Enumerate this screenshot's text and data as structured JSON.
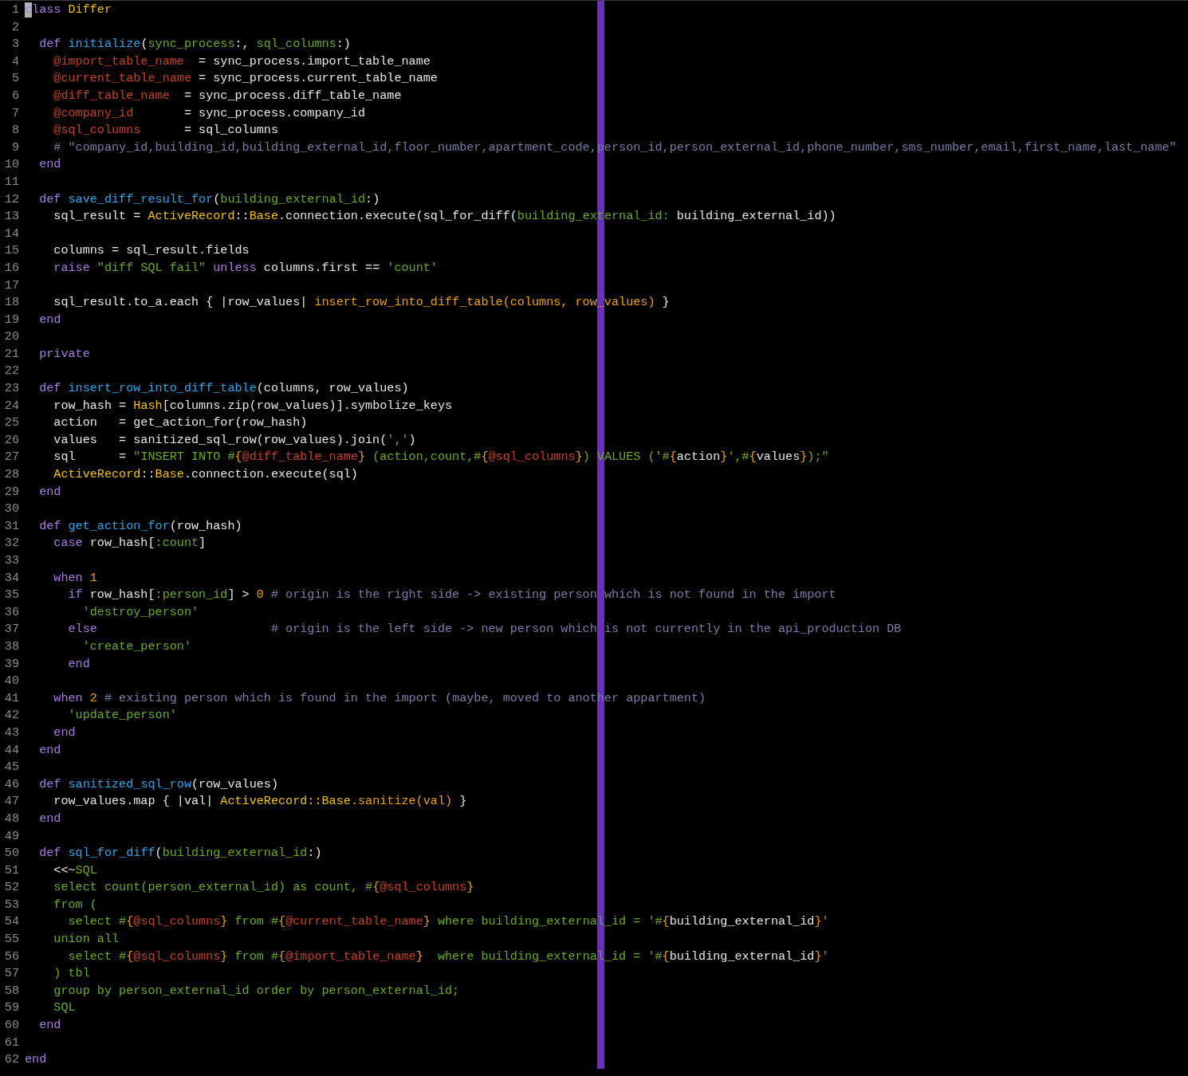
{
  "lines": [
    {
      "number": "1",
      "cursor": true,
      "tokens": [
        {
          "kind": "keyword",
          "text": "class"
        },
        {
          "kind": "constant",
          "text": " Differ"
        }
      ]
    },
    {
      "number": "2",
      "cursor": false
    },
    {
      "number": "3",
      "cursor": false,
      "tokens": [
        {
          "kind": "keyword",
          "text": "  def"
        },
        {
          "kind": "function",
          "text": " initialize"
        },
        {
          "kind": "plain",
          "text": "("
        },
        {
          "kind": "param",
          "text": "sync_process"
        },
        {
          "kind": "plain",
          "text": ":, "
        },
        {
          "kind": "param",
          "text": "sql_columns"
        },
        {
          "kind": "plain",
          "text": ":)"
        }
      ]
    },
    {
      "number": "4",
      "cursor": false,
      "tokens": [
        {
          "kind": "ivar",
          "text": "    @import_table_name"
        },
        {
          "kind": "plain",
          "text": "  = sync_process.import_table_name"
        }
      ]
    },
    {
      "number": "5",
      "cursor": false,
      "tokens": [
        {
          "kind": "ivar",
          "text": "    @current_table_name"
        },
        {
          "kind": "plain",
          "text": " = sync_process.current_table_name"
        }
      ]
    },
    {
      "number": "6",
      "cursor": false,
      "tokens": [
        {
          "kind": "ivar",
          "text": "    @diff_table_name"
        },
        {
          "kind": "plain",
          "text": "  = sync_process.diff_table_name"
        }
      ]
    },
    {
      "number": "7",
      "cursor": false,
      "tokens": [
        {
          "kind": "ivar",
          "text": "    @company_id"
        },
        {
          "kind": "plain",
          "text": "       = sync_process.company_id"
        }
      ]
    },
    {
      "number": "8",
      "cursor": false,
      "tokens": [
        {
          "kind": "ivar",
          "text": "    @sql_columns"
        },
        {
          "kind": "plain",
          "text": "      = sql_columns"
        }
      ]
    },
    {
      "number": "9",
      "cursor": false,
      "tokens": [
        {
          "kind": "comment",
          "text": "    # \"company_id,building_id,building_external_id,floor_number,apartment_code,person_id,person_external_id,phone_number,sms_number,email,first_name,last_name\""
        }
      ]
    },
    {
      "number": "10",
      "cursor": false,
      "tokens": [
        {
          "kind": "keyword",
          "text": "  end"
        }
      ]
    },
    {
      "number": "11",
      "cursor": false
    },
    {
      "number": "12",
      "cursor": false,
      "tokens": [
        {
          "kind": "keyword",
          "text": "  def"
        },
        {
          "kind": "function",
          "text": " save_diff_result_for"
        },
        {
          "kind": "plain",
          "text": "("
        },
        {
          "kind": "param",
          "text": "building_external_id"
        },
        {
          "kind": "plain",
          "text": ":)"
        }
      ]
    },
    {
      "number": "13",
      "cursor": false,
      "tokens": [
        {
          "kind": "plain",
          "text": "    sql_result = "
        },
        {
          "kind": "constant",
          "text": "ActiveRecord"
        },
        {
          "kind": "plain",
          "text": "::"
        },
        {
          "kind": "constant",
          "text": "Base"
        },
        {
          "kind": "plain",
          "text": ".connection.execute(sql_for_diff("
        },
        {
          "kind": "param",
          "text": "building_external_id:"
        },
        {
          "kind": "plain",
          "text": " building_external_id))"
        }
      ]
    },
    {
      "number": "14",
      "cursor": false
    },
    {
      "number": "15",
      "cursor": false,
      "tokens": [
        {
          "kind": "plain",
          "text": "    columns = sql_result.fields"
        }
      ]
    },
    {
      "number": "16",
      "cursor": false,
      "tokens": [
        {
          "kind": "keyword",
          "text": "    raise"
        },
        {
          "kind": "string",
          "text": " \"diff SQL fail\""
        },
        {
          "kind": "keyword",
          "text": " unless"
        },
        {
          "kind": "plain",
          "text": " columns.first == "
        },
        {
          "kind": "string",
          "text": "'count'"
        }
      ]
    },
    {
      "number": "17",
      "cursor": false
    },
    {
      "number": "18",
      "cursor": false,
      "tokens": [
        {
          "kind": "plain",
          "text": "    sql_result.to_a.each { |row_values| "
        },
        {
          "kind": "call",
          "text": "insert_row_into_diff_table(columns, row_values)"
        },
        {
          "kind": "plain",
          "text": " }"
        }
      ]
    },
    {
      "number": "19",
      "cursor": false,
      "tokens": [
        {
          "kind": "keyword",
          "text": "  end"
        }
      ]
    },
    {
      "number": "20",
      "cursor": false
    },
    {
      "number": "21",
      "cursor": false,
      "tokens": [
        {
          "kind": "keyword",
          "text": "  private"
        }
      ]
    },
    {
      "number": "22",
      "cursor": false
    },
    {
      "number": "23",
      "cursor": false,
      "tokens": [
        {
          "kind": "keyword",
          "text": "  def"
        },
        {
          "kind": "function",
          "text": " insert_row_into_diff_table"
        },
        {
          "kind": "plain",
          "text": "(columns, row_values)"
        }
      ]
    },
    {
      "number": "24",
      "cursor": false,
      "tokens": [
        {
          "kind": "plain",
          "text": "    row_hash = "
        },
        {
          "kind": "constant",
          "text": "Hash"
        },
        {
          "kind": "plain",
          "text": "[columns.zip(row_values)].symbolize_keys"
        }
      ]
    },
    {
      "number": "25",
      "cursor": false,
      "tokens": [
        {
          "kind": "plain",
          "text": "    action   = get_action_for(row_hash)"
        }
      ]
    },
    {
      "number": "26",
      "cursor": false,
      "tokens": [
        {
          "kind": "plain",
          "text": "    values   = sanitized_sql_row(row_values).join("
        },
        {
          "kind": "string",
          "text": "','"
        },
        {
          "kind": "plain",
          "text": ")"
        }
      ]
    },
    {
      "number": "27",
      "cursor": false,
      "tokens": [
        {
          "kind": "plain",
          "text": "    sql      = "
        },
        {
          "kind": "string",
          "text": "\"INSERT INTO #"
        },
        {
          "kind": "interp",
          "text": "{"
        },
        {
          "kind": "ivar",
          "text": "@diff_table_name"
        },
        {
          "kind": "interp",
          "text": "}"
        },
        {
          "kind": "string",
          "text": " (action,count,#"
        },
        {
          "kind": "interp",
          "text": "{"
        },
        {
          "kind": "ivar",
          "text": "@sql_columns"
        },
        {
          "kind": "interp",
          "text": "}"
        },
        {
          "kind": "string",
          "text": ") VALUES ('#"
        },
        {
          "kind": "interp",
          "text": "{"
        },
        {
          "kind": "plain",
          "text": "action"
        },
        {
          "kind": "interp",
          "text": "}"
        },
        {
          "kind": "string",
          "text": "',#"
        },
        {
          "kind": "interp",
          "text": "{"
        },
        {
          "kind": "plain",
          "text": "values"
        },
        {
          "kind": "interp",
          "text": "}"
        },
        {
          "kind": "string",
          "text": ");\""
        }
      ]
    },
    {
      "number": "28",
      "cursor": false,
      "tokens": [
        {
          "kind": "constant",
          "text": "    ActiveRecord"
        },
        {
          "kind": "plain",
          "text": "::"
        },
        {
          "kind": "constant",
          "text": "Base"
        },
        {
          "kind": "plain",
          "text": ".connection.execute(sql)"
        }
      ]
    },
    {
      "number": "29",
      "cursor": false,
      "tokens": [
        {
          "kind": "keyword",
          "text": "  end"
        }
      ]
    },
    {
      "number": "30",
      "cursor": false
    },
    {
      "number": "31",
      "cursor": false,
      "tokens": [
        {
          "kind": "keyword",
          "text": "  def"
        },
        {
          "kind": "function",
          "text": " get_action_for"
        },
        {
          "kind": "plain",
          "text": "(row_hash)"
        }
      ]
    },
    {
      "number": "32",
      "cursor": false,
      "tokens": [
        {
          "kind": "keyword",
          "text": "    case"
        },
        {
          "kind": "plain",
          "text": " row_hash["
        },
        {
          "kind": "string",
          "text": ":count"
        },
        {
          "kind": "plain",
          "text": "]"
        }
      ]
    },
    {
      "number": "33",
      "cursor": false
    },
    {
      "number": "34",
      "cursor": false,
      "tokens": [
        {
          "kind": "keyword",
          "text": "    when"
        },
        {
          "kind": "number",
          "text": " 1"
        }
      ]
    },
    {
      "number": "35",
      "cursor": false,
      "tokens": [
        {
          "kind": "keyword",
          "text": "      if"
        },
        {
          "kind": "plain",
          "text": " row_hash["
        },
        {
          "kind": "string",
          "text": ":person_id"
        },
        {
          "kind": "plain",
          "text": "] > "
        },
        {
          "kind": "number",
          "text": "0"
        },
        {
          "kind": "comment",
          "text": " # origin is the right side -> existing person which is not found in the import"
        }
      ]
    },
    {
      "number": "36",
      "cursor": false,
      "tokens": [
        {
          "kind": "string",
          "text": "        'destroy_person'"
        }
      ]
    },
    {
      "number": "37",
      "cursor": false,
      "tokens": [
        {
          "kind": "keyword",
          "text": "      else"
        },
        {
          "kind": "comment",
          "text": "                        # origin is the left side -> new person which is not currently in the api_production DB"
        }
      ]
    },
    {
      "number": "38",
      "cursor": false,
      "tokens": [
        {
          "kind": "string",
          "text": "        'create_person'"
        }
      ]
    },
    {
      "number": "39",
      "cursor": false,
      "tokens": [
        {
          "kind": "keyword",
          "text": "      end"
        }
      ]
    },
    {
      "number": "40",
      "cursor": false
    },
    {
      "number": "41",
      "cursor": false,
      "tokens": [
        {
          "kind": "keyword",
          "text": "    when"
        },
        {
          "kind": "number",
          "text": " 2"
        },
        {
          "kind": "comment",
          "text": " # existing person which is found in the import (maybe, moved to another appartment)"
        }
      ]
    },
    {
      "number": "42",
      "cursor": false,
      "tokens": [
        {
          "kind": "string",
          "text": "      'update_person'"
        }
      ]
    },
    {
      "number": "43",
      "cursor": false,
      "tokens": [
        {
          "kind": "keyword",
          "text": "    end"
        }
      ]
    },
    {
      "number": "44",
      "cursor": false,
      "tokens": [
        {
          "kind": "keyword",
          "text": "  end"
        }
      ]
    },
    {
      "number": "45",
      "cursor": false
    },
    {
      "number": "46",
      "cursor": false,
      "tokens": [
        {
          "kind": "keyword",
          "text": "  def"
        },
        {
          "kind": "function",
          "text": " sanitized_sql_row"
        },
        {
          "kind": "plain",
          "text": "(row_values)"
        }
      ]
    },
    {
      "number": "47",
      "cursor": false,
      "tokens": [
        {
          "kind": "plain",
          "text": "    row_values.map { |val| "
        },
        {
          "kind": "constant",
          "text": "ActiveRecord::Base"
        },
        {
          "kind": "call",
          "text": ".sanitize(val)"
        },
        {
          "kind": "plain",
          "text": " }"
        }
      ]
    },
    {
      "number": "48",
      "cursor": false,
      "tokens": [
        {
          "kind": "keyword",
          "text": "  end"
        }
      ]
    },
    {
      "number": "49",
      "cursor": false
    },
    {
      "number": "50",
      "cursor": false,
      "tokens": [
        {
          "kind": "keyword",
          "text": "  def"
        },
        {
          "kind": "function",
          "text": " sql_for_diff"
        },
        {
          "kind": "plain",
          "text": "("
        },
        {
          "kind": "param",
          "text": "building_external_id"
        },
        {
          "kind": "plain",
          "text": ":)"
        }
      ]
    },
    {
      "number": "51",
      "cursor": false,
      "tokens": [
        {
          "kind": "plain",
          "text": "    <<~"
        },
        {
          "kind": "string",
          "text": "SQL"
        }
      ]
    },
    {
      "number": "52",
      "cursor": false,
      "tokens": [
        {
          "kind": "string",
          "text": "    select count(person_external_id) as count, #"
        },
        {
          "kind": "interp",
          "text": "{"
        },
        {
          "kind": "ivar",
          "text": "@sql_columns"
        },
        {
          "kind": "interp",
          "text": "}"
        }
      ]
    },
    {
      "number": "53",
      "cursor": false,
      "tokens": [
        {
          "kind": "string",
          "text": "    from ("
        }
      ]
    },
    {
      "number": "54",
      "cursor": false,
      "tokens": [
        {
          "kind": "string",
          "text": "      select #"
        },
        {
          "kind": "interp",
          "text": "{"
        },
        {
          "kind": "ivar",
          "text": "@sql_columns"
        },
        {
          "kind": "interp",
          "text": "}"
        },
        {
          "kind": "string",
          "text": " from #"
        },
        {
          "kind": "interp",
          "text": "{"
        },
        {
          "kind": "ivar",
          "text": "@current_table_name"
        },
        {
          "kind": "interp",
          "text": "}"
        },
        {
          "kind": "string",
          "text": " where building_external_id = '#"
        },
        {
          "kind": "interp",
          "text": "{"
        },
        {
          "kind": "plain",
          "text": "building_external_id"
        },
        {
          "kind": "interp",
          "text": "}"
        },
        {
          "kind": "string",
          "text": "'"
        }
      ]
    },
    {
      "number": "55",
      "cursor": false,
      "tokens": [
        {
          "kind": "string",
          "text": "    union all"
        }
      ]
    },
    {
      "number": "56",
      "cursor": false,
      "tokens": [
        {
          "kind": "string",
          "text": "      select #"
        },
        {
          "kind": "interp",
          "text": "{"
        },
        {
          "kind": "ivar",
          "text": "@sql_columns"
        },
        {
          "kind": "interp",
          "text": "}"
        },
        {
          "kind": "string",
          "text": " from #"
        },
        {
          "kind": "interp",
          "text": "{"
        },
        {
          "kind": "ivar",
          "text": "@import_table_name"
        },
        {
          "kind": "interp",
          "text": "}"
        },
        {
          "kind": "string",
          "text": "  where building_external_id = '#"
        },
        {
          "kind": "interp",
          "text": "{"
        },
        {
          "kind": "plain",
          "text": "building_external_id"
        },
        {
          "kind": "interp",
          "text": "}"
        },
        {
          "kind": "string",
          "text": "'"
        }
      ]
    },
    {
      "number": "57",
      "cursor": false,
      "tokens": [
        {
          "kind": "string",
          "text": "    ) tbl"
        }
      ]
    },
    {
      "number": "58",
      "cursor": false,
      "tokens": [
        {
          "kind": "string",
          "text": "    group by person_external_id order by person_external_id;"
        }
      ]
    },
    {
      "number": "59",
      "cursor": false,
      "tokens": [
        {
          "kind": "string",
          "text": "    SQL"
        }
      ]
    },
    {
      "number": "60",
      "cursor": false,
      "tokens": [
        {
          "kind": "keyword",
          "text": "  end"
        }
      ]
    },
    {
      "number": "61",
      "cursor": false
    },
    {
      "number": "62",
      "cursor": false,
      "tokens": [
        {
          "kind": "keyword",
          "text": "end"
        }
      ]
    }
  ]
}
